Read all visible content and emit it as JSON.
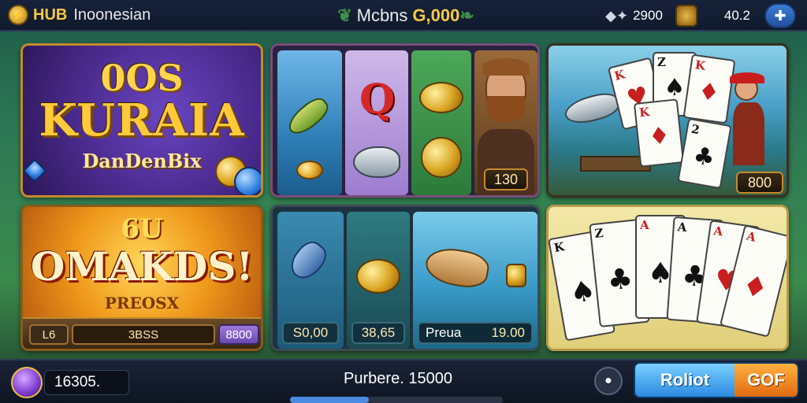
{
  "topbar": {
    "brand_icon": "lightning-coin-icon",
    "brand_hub": "HUB",
    "brand_sub": "Inoonesian",
    "title": "Mcbns",
    "title_amount": "G,000",
    "stat1_icon": "gems-icon",
    "stat1_value": "2900",
    "stat2_icon": "coin-badge-icon",
    "stat2_value": "40.2",
    "pad_icon": "gamepad-icon"
  },
  "panels": {
    "p1": {
      "top": "0OS",
      "main": "KURAIA",
      "sub": "DanDenBix"
    },
    "p2": {
      "badge": "130"
    },
    "p3": {
      "badge": "800",
      "cards": [
        "K",
        "Z",
        "K",
        "K",
        "2"
      ]
    },
    "p4": {
      "top": "6U",
      "main": "OMAKDS!",
      "sub": "PREOSX",
      "mini_left": "L6",
      "mini_mid": "3BSS",
      "mini_right": "8800"
    },
    "p5": {
      "badge1": "S0,00",
      "badge2": "38,65",
      "badge3_label": "Preua",
      "badge3_value": "19.00"
    },
    "p6": {
      "cards": [
        "K",
        "Z",
        "A",
        "A",
        "A",
        "A"
      ]
    }
  },
  "bottombar": {
    "chest_icon": "treasure-chest-icon",
    "balance": "16305.",
    "purchase_label": "Purbere.",
    "purchase_value": "15000",
    "progress": 0.37,
    "round_icon": "chat-icon",
    "action_left": "Roliot",
    "action_right": "GOF"
  },
  "colors": {
    "accent_gold": "#f7c948",
    "button_blue": "#2a8ae0",
    "button_orange": "#e06a10"
  }
}
